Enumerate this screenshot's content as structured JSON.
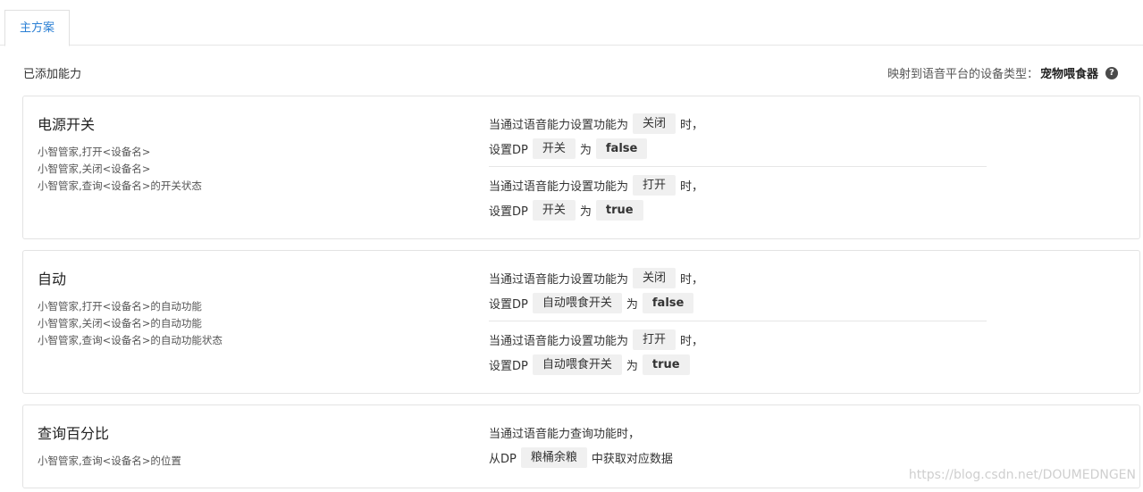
{
  "tabs": [
    {
      "label": "主方案",
      "active": true
    }
  ],
  "header": {
    "section_title": "已添加能力",
    "device_type_label": "映射到语音平台的设备类型：",
    "device_type_value": "宠物喂食器",
    "help_icon": "?"
  },
  "cards": [
    {
      "name": "电源开关",
      "utterances": [
        "小智管家,打开<设备名>",
        "小智管家,关闭<设备名>",
        "小智管家,查询<设备名>的开关状态"
      ],
      "rules": [
        {
          "when_prefix": "当通过语音能力设置功能为",
          "when_value": "关闭",
          "when_suffix": "时，",
          "set_prefix": "设置DP",
          "dp": "开关",
          "as": "为",
          "value": "false"
        },
        {
          "when_prefix": "当通过语音能力设置功能为",
          "when_value": "打开",
          "when_suffix": "时，",
          "set_prefix": "设置DP",
          "dp": "开关",
          "as": "为",
          "value": "true"
        }
      ]
    },
    {
      "name": "自动",
      "utterances": [
        "小智管家,打开<设备名>的自动功能",
        "小智管家,关闭<设备名>的自动功能",
        "小智管家,查询<设备名>的自动功能状态"
      ],
      "rules": [
        {
          "when_prefix": "当通过语音能力设置功能为",
          "when_value": "关闭",
          "when_suffix": "时，",
          "set_prefix": "设置DP",
          "dp": "自动喂食开关",
          "as": "为",
          "value": "false"
        },
        {
          "when_prefix": "当通过语音能力设置功能为",
          "when_value": "打开",
          "when_suffix": "时，",
          "set_prefix": "设置DP",
          "dp": "自动喂食开关",
          "as": "为",
          "value": "true"
        }
      ]
    },
    {
      "name": "查询百分比",
      "utterances": [
        "小智管家,查询<设备名>的位置"
      ],
      "query": {
        "line1": "当通过语音能力查询功能时，",
        "from_prefix": "从DP",
        "dp": "粮桶余粮",
        "suffix": "中获取对应数据"
      }
    }
  ],
  "watermark": "https://blog.csdn.net/DOUMEDNGEN"
}
